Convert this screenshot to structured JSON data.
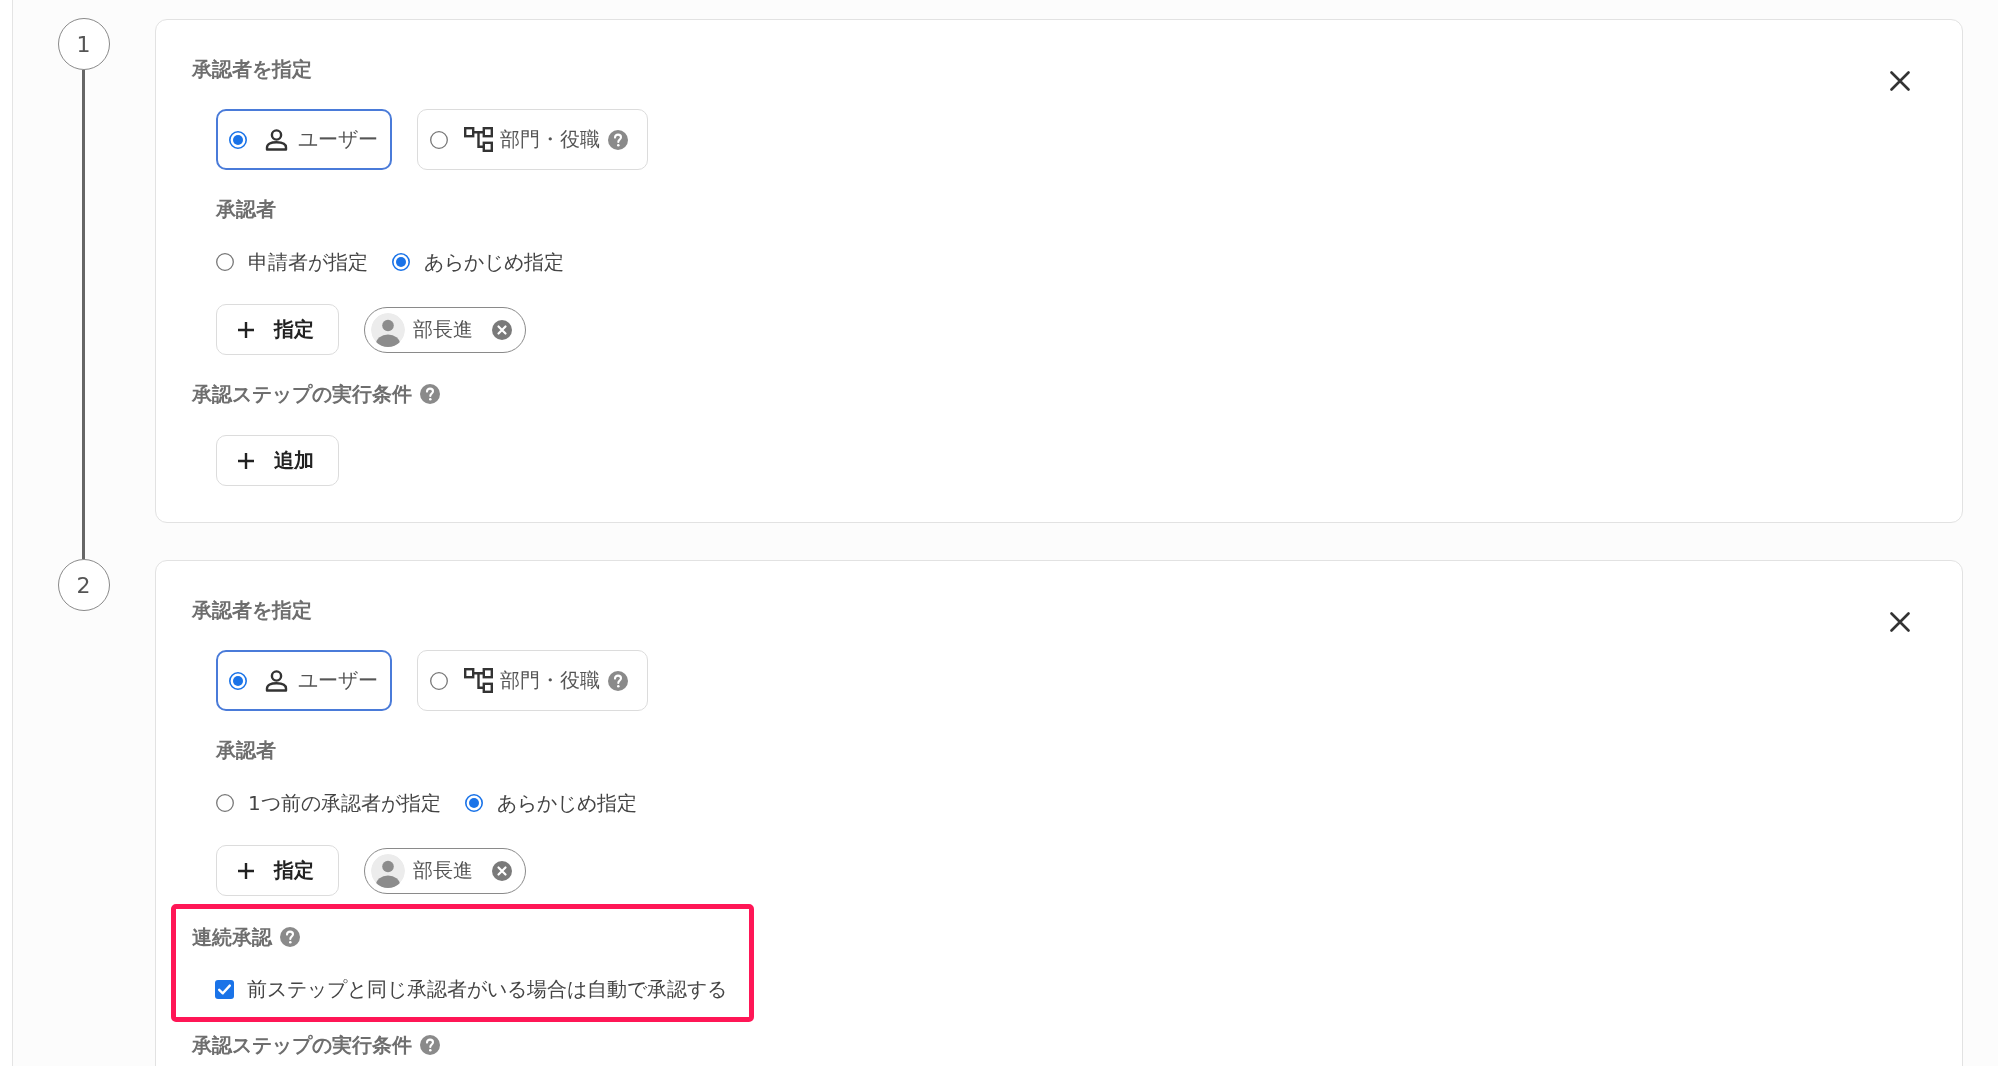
{
  "steps": [
    {
      "number": "1",
      "approver_type_label": "承認者を指定",
      "approver_types": [
        {
          "kind": "user",
          "label": "ユーザー",
          "selected": true
        },
        {
          "kind": "org",
          "label": "部門・役職",
          "selected": false
        }
      ],
      "approver_label": "承認者",
      "approver_modes": [
        {
          "label": "申請者が指定",
          "selected": false
        },
        {
          "label": "あらかじめ指定",
          "selected": true
        }
      ],
      "assign_button": "指定",
      "approvers": [
        {
          "name": "部長進"
        }
      ],
      "condition_label": "承認ステップの実行条件",
      "add_condition_button": "追加"
    },
    {
      "number": "2",
      "approver_type_label": "承認者を指定",
      "approver_types": [
        {
          "kind": "user",
          "label": "ユーザー",
          "selected": true
        },
        {
          "kind": "org",
          "label": "部門・役職",
          "selected": false
        }
      ],
      "approver_label": "承認者",
      "approver_modes": [
        {
          "label": "1つ前の承認者が指定",
          "selected": false
        },
        {
          "label": "あらかじめ指定",
          "selected": true
        }
      ],
      "assign_button": "指定",
      "approvers": [
        {
          "name": "部長進"
        }
      ],
      "consecutive_approval": {
        "label": "連続承認",
        "option": "前ステップと同じ承認者がいる場合は自動で承認する",
        "checked": true,
        "highlighted": true
      },
      "condition_label": "承認ステップの実行条件"
    }
  ]
}
